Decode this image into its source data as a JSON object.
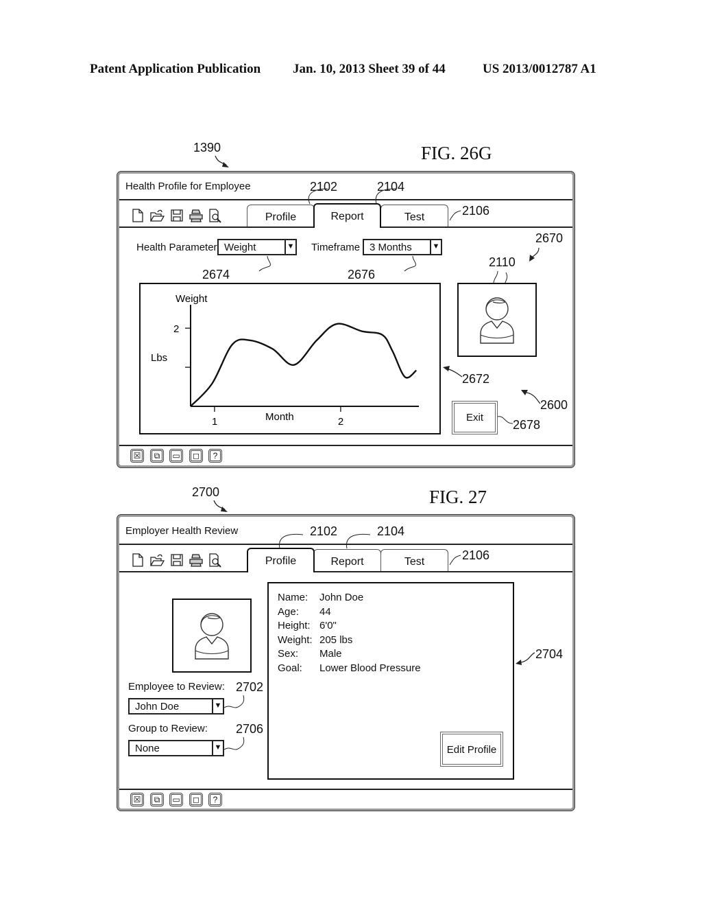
{
  "header": {
    "left": "Patent Application Publication",
    "date_sheet": "Jan. 10, 2013  Sheet 39 of 44",
    "pub_number": "US 2013/0012787 A1"
  },
  "fig26g": {
    "fig_label": "FIG. 26G",
    "ref_window": "1390",
    "window_title": "Health Profile for Employee",
    "tabs": [
      {
        "label": "Profile",
        "ref": "2102",
        "active": false
      },
      {
        "label": "Report",
        "ref": "2104",
        "active": true
      },
      {
        "label": "Test",
        "ref": "2106",
        "active": false
      }
    ],
    "toolbar_icons": [
      "new-file-icon",
      "open-folder-icon",
      "save-icon",
      "print-icon",
      "print-preview-icon"
    ],
    "health_parameter": {
      "label": "Health Parameter",
      "value": "Weight",
      "ref": "2674"
    },
    "timeframe": {
      "label": "Timeframe",
      "value": "3 Months",
      "ref": "2676"
    },
    "refs": {
      "panel": "2670",
      "avatar": "2110",
      "chart": "2672",
      "screen": "2600",
      "exit": "2678"
    },
    "exit_label": "Exit",
    "status_buttons": [
      "close-icon",
      "restore-icon",
      "minimize-icon",
      "maximize-icon",
      "help-icon"
    ],
    "status_glyphs": [
      "☒",
      "⧉",
      "▭",
      "◻",
      "?"
    ]
  },
  "chart_data": {
    "type": "line",
    "title": "Weight",
    "xlabel": "Month",
    "ylabel": "Lbs",
    "x_ticks": [
      1,
      2
    ],
    "x_tick_labels": [
      "1",
      "2"
    ],
    "y_ticks": [
      1,
      2
    ],
    "y_tick_labels": [
      "",
      "2"
    ],
    "xlim": [
      0.81,
      2.62
    ],
    "ylim": [
      0,
      2.6
    ],
    "grid": false,
    "series": [
      {
        "name": "Weight",
        "x": [
          0.81,
          0.98,
          1.14,
          1.28,
          1.46,
          1.63,
          1.81,
          1.97,
          2.17,
          2.33,
          2.41,
          2.51,
          2.6
        ],
        "y": [
          0.0,
          0.58,
          1.58,
          1.69,
          1.47,
          1.06,
          1.69,
          2.11,
          1.92,
          1.83,
          1.42,
          0.75,
          0.92
        ]
      }
    ]
  },
  "fig27": {
    "fig_label": "FIG. 27",
    "ref_window": "2700",
    "window_title": "Employer Health Review",
    "tabs": [
      {
        "label": "Profile",
        "ref": "2102",
        "active": true
      },
      {
        "label": "Report",
        "ref": "2104",
        "active": false
      },
      {
        "label": "Test",
        "ref": "2106",
        "active": false
      }
    ],
    "employee": {
      "label": "Employee to Review:",
      "value": "John Doe",
      "ref": "2702"
    },
    "group": {
      "label": "Group to Review:",
      "value": "None",
      "ref": "2706"
    },
    "profile_ref": "2704",
    "profile": [
      {
        "key": "Name:",
        "value": "John Doe"
      },
      {
        "key": "Age:",
        "value": "44"
      },
      {
        "key": "Height:",
        "value": "6'0\""
      },
      {
        "key": "Weight:",
        "value": "205 lbs"
      },
      {
        "key": "Sex:",
        "value": "Male"
      },
      {
        "key": "Goal:",
        "value": "Lower Blood Pressure"
      }
    ],
    "edit_profile_label": "Edit Profile",
    "status_glyphs": [
      "☒",
      "⧉",
      "▭",
      "◻",
      "?"
    ]
  }
}
